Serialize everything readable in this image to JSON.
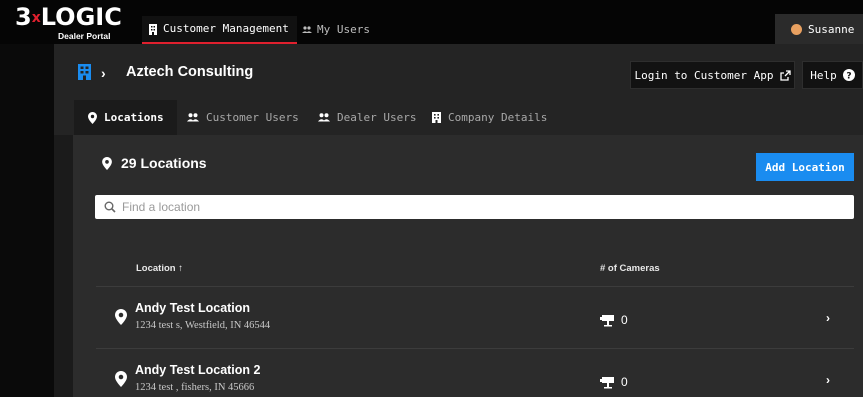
{
  "brand": {
    "logo_prefix": "3",
    "logo_x": "x",
    "logo_main": "LOGIC",
    "logo_sub": "Dealer Portal"
  },
  "topnav": {
    "tabs": [
      {
        "label": "Customer Management",
        "icon": "building-icon",
        "active": true
      },
      {
        "label": "My Users",
        "icon": "users-icon",
        "active": false
      }
    ],
    "user": {
      "name": "Susanne"
    }
  },
  "header": {
    "breadcrumb_sep": "›",
    "title": "Aztech Consulting",
    "login_button": "Login to Customer App",
    "help_button": "Help"
  },
  "subtabs": [
    {
      "label": "Locations",
      "icon": "pin-icon",
      "active": true
    },
    {
      "label": "Customer Users",
      "icon": "users-icon",
      "active": false
    },
    {
      "label": "Dealer Users",
      "icon": "users-icon",
      "active": false
    },
    {
      "label": "Company Details",
      "icon": "building-icon",
      "active": false
    }
  ],
  "locations": {
    "count_label": "29 Locations",
    "add_button": "Add Location",
    "search_placeholder": "Find a location",
    "columns": {
      "location": "Location",
      "sort_arrow": "↑",
      "cameras": "# of Cameras"
    },
    "rows": [
      {
        "name": "Andy Test Location",
        "address": "1234 test s, Westfield, IN 46544",
        "cameras": "0"
      },
      {
        "name": "Andy Test Location 2",
        "address": "1234 test , fishers, IN 45666",
        "cameras": "0"
      }
    ]
  },
  "colors": {
    "accent": "#1a8cf0",
    "brand_red": "#e0202e",
    "topbar": "#050505",
    "panel": "#2c2c2c"
  }
}
